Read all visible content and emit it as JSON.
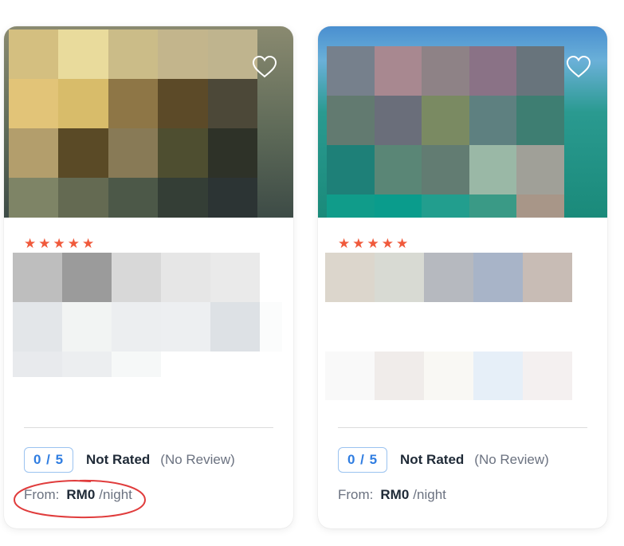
{
  "cards": [
    {
      "star_count": 5,
      "stars": [
        "★",
        "★",
        "★",
        "★",
        "★"
      ],
      "score": "0 / 5",
      "rating_label": "Not Rated",
      "review_count": "(No Review)",
      "price_from_label": "From:",
      "price_amount": "RM0",
      "price_unit": "/night",
      "favorite_icon": "heart-outline-icon",
      "image_mosaic": [
        "#d4bf80",
        "#e9db9c",
        "#cbbc88",
        "#c3b58c",
        "#bfb48e",
        "#e2c478",
        "#d8bc6a",
        "#8e7646",
        "#5c4a28",
        "#4c4838",
        "#b39e6c",
        "#5a4a26",
        "#887a56",
        "#4e4e30",
        "#2e3228",
        "#7e8466",
        "#646a52",
        "#4c5848",
        "#343e36",
        "#2c3434"
      ],
      "text_mosaic": [
        "#bebebe",
        "#9b9b9b",
        "#d8d8d8",
        "#e6e6e6",
        "#eaeaea",
        "#ffffff",
        "#e3e6e9",
        "#f2f4f3",
        "#eceef0",
        "#edeff1",
        "#dde1e5",
        "#fbfcfc",
        "#e8eaed",
        "#eceef0",
        "#f6f8f8",
        "#ffffff",
        "#ffffff",
        "#ffffff"
      ]
    },
    {
      "star_count": 5,
      "stars": [
        "★",
        "★",
        "★",
        "★",
        "★"
      ],
      "score": "0 / 5",
      "rating_label": "Not Rated",
      "review_count": "(No Review)",
      "price_from_label": "From:",
      "price_amount": "RM0",
      "price_unit": "/night",
      "favorite_icon": "heart-outline-icon",
      "image_mosaic": [
        "#76808c",
        "#a88890",
        "#8e8286",
        "#8a7286",
        "#68747c",
        "#627a70",
        "#6a6e7a",
        "#7a8a62",
        "#5e8080",
        "#3e7e72",
        "#1e8078",
        "#5a8676",
        "#627c72",
        "#9ab8a6",
        "#a0a098",
        "#109c8a",
        "#0a9c8c",
        "#229e8e",
        "#3a9a86",
        "#a89688"
      ],
      "text_mosaic": [
        "#dcd6cc",
        "#d8dad3",
        "#b6b9bf",
        "#a8b4c8",
        "#c8bcb5",
        "#ffffff",
        "#ffffff",
        "#ffffff",
        "#ffffff",
        "#ffffff",
        "#f9f9f9",
        "#f0ecea",
        "#f9f8f4",
        "#e6eff8",
        "#f4f0f0"
      ]
    }
  ],
  "colors": {
    "star": "#f05a3c",
    "score_text": "#2f7de1",
    "score_border": "#9bc3f0",
    "heading_text": "#1f2a37",
    "muted_text": "#6b7280",
    "annotation_ellipse": "#e03c3c"
  }
}
